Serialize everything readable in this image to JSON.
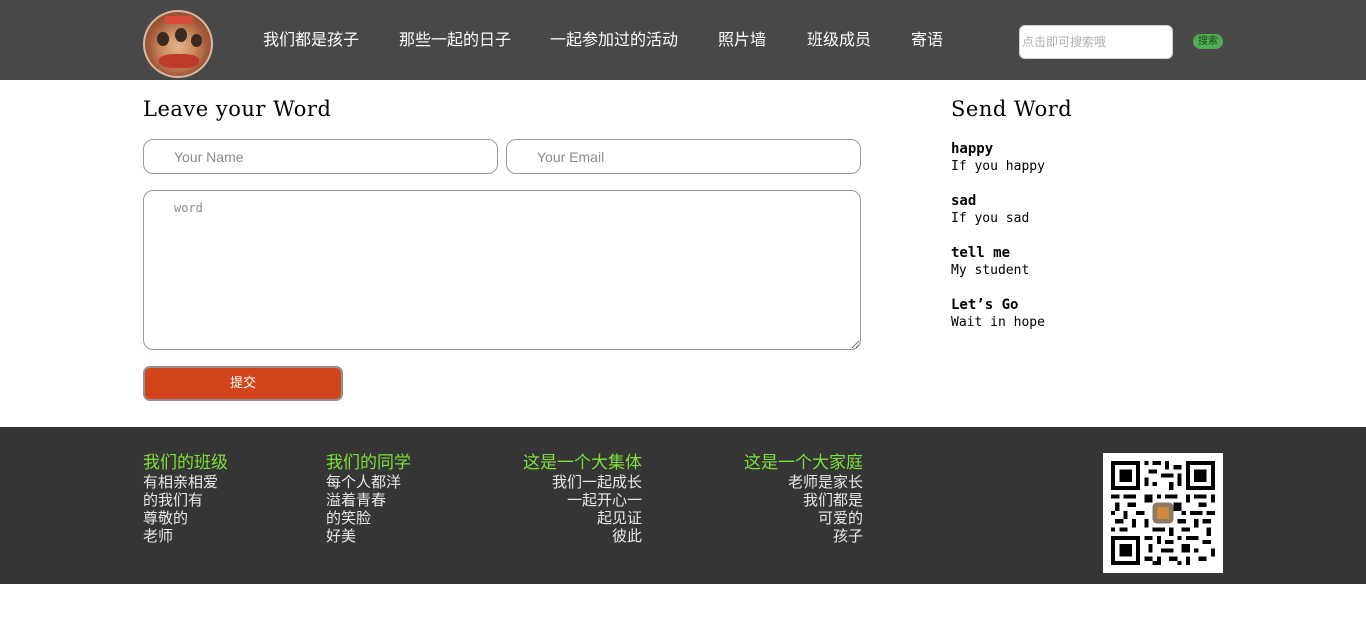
{
  "header": {
    "logo_icon": "class-photo-avatar-icon",
    "nav": [
      {
        "label": "我们都是孩子"
      },
      {
        "label": "那些一起的日子"
      },
      {
        "label": "一起参加过的活动"
      },
      {
        "label": "照片墙"
      },
      {
        "label": "班级成员"
      },
      {
        "label": "寄语"
      }
    ],
    "search_placeholder": "点击即可搜索哦",
    "search_button": "搜索"
  },
  "main": {
    "title": "Leave your Word",
    "name_placeholder": "Your Name",
    "email_placeholder": "Your Email",
    "word_placeholder": "word",
    "submit_label": "提交"
  },
  "sidebar": {
    "title": "Send Word",
    "entries": [
      {
        "title": "happy",
        "desc": "If you happy"
      },
      {
        "title": "sad",
        "desc": "If you sad"
      },
      {
        "title": "tell me",
        "desc": "My student"
      },
      {
        "title": "Let’s Go",
        "desc": "Wait in hope"
      }
    ]
  },
  "footer": {
    "columns": [
      {
        "title": "我们的班级",
        "lines": [
          "有相亲相爱",
          "的我们有",
          "尊敬的",
          "老师"
        ]
      },
      {
        "title": "我们的同学",
        "lines": [
          "每个人都洋",
          "溢着青春",
          "的笑脸",
          "好美"
        ]
      },
      {
        "title": "这是一个大集体",
        "lines": [
          "我们一起成长",
          "一起开心一",
          "起见证",
          "彼此"
        ]
      },
      {
        "title": "这是一个大家庭",
        "lines": [
          "老师是家长",
          "我们都是",
          "可爱的",
          "孩子"
        ]
      }
    ],
    "qr_icon": "qr-code-icon"
  },
  "colors": {
    "header_bg": "#484848",
    "footer_bg": "#353535",
    "accent_green": "#7fe03a",
    "submit_bg": "#d2441c",
    "search_button_bg": "#4caf50"
  }
}
